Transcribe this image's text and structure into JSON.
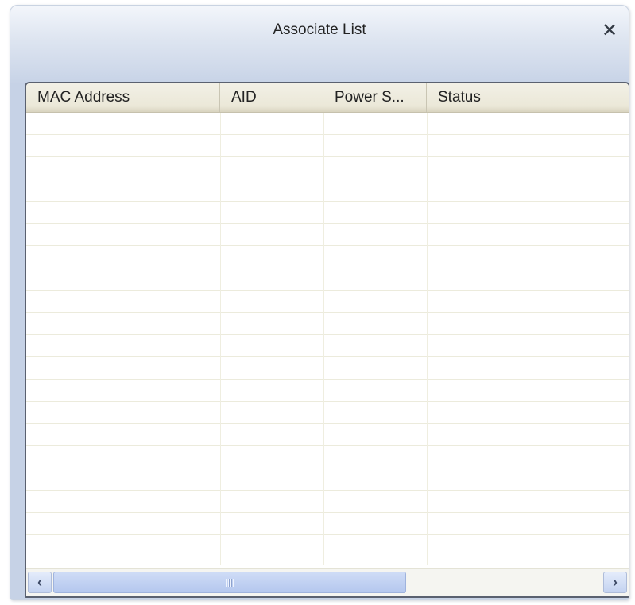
{
  "window": {
    "title": "Associate List",
    "close_icon_glyph": "✕"
  },
  "table": {
    "columns": [
      "MAC Address",
      "AID",
      "Power S...",
      "Status"
    ],
    "rows": []
  },
  "scrollbar": {
    "left_icon_glyph": "‹",
    "right_icon_glyph": "›"
  }
}
